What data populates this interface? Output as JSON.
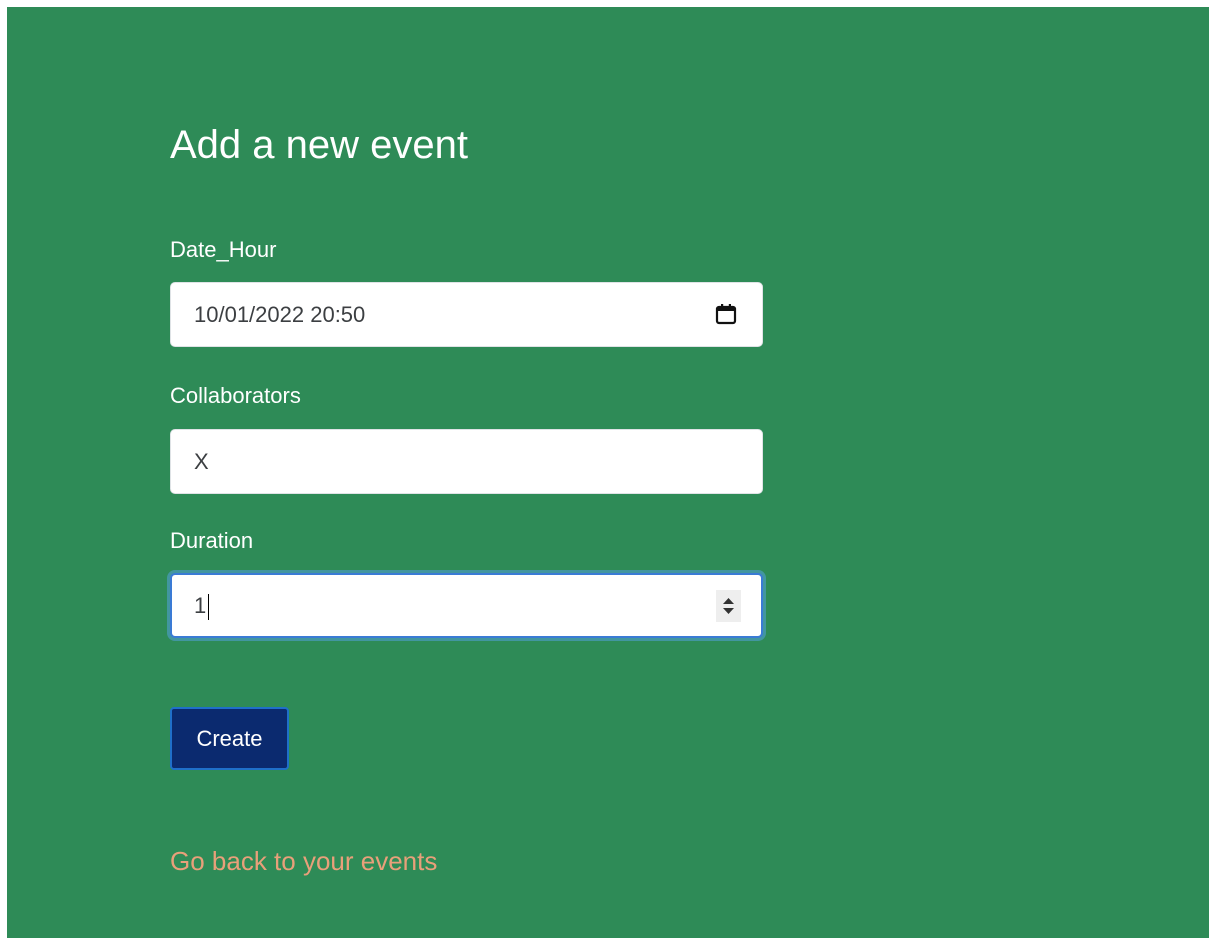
{
  "form": {
    "title": "Add a new event",
    "date_hour": {
      "label": "Date_Hour",
      "value": "10/01/2022 20:50"
    },
    "collaborators": {
      "label": "Collaborators",
      "value": "X"
    },
    "duration": {
      "label": "Duration",
      "value": "1"
    },
    "submit_label": "Create"
  },
  "footer": {
    "back_link": "Go back to your events"
  },
  "colors": {
    "background": "#2e8b57",
    "button": "#0b2a6f",
    "link": "#e8a07a",
    "text": "#ffffff"
  },
  "icons": {
    "date_picker": "calendar-icon",
    "number_spinner": "spinner-arrows-icon"
  }
}
